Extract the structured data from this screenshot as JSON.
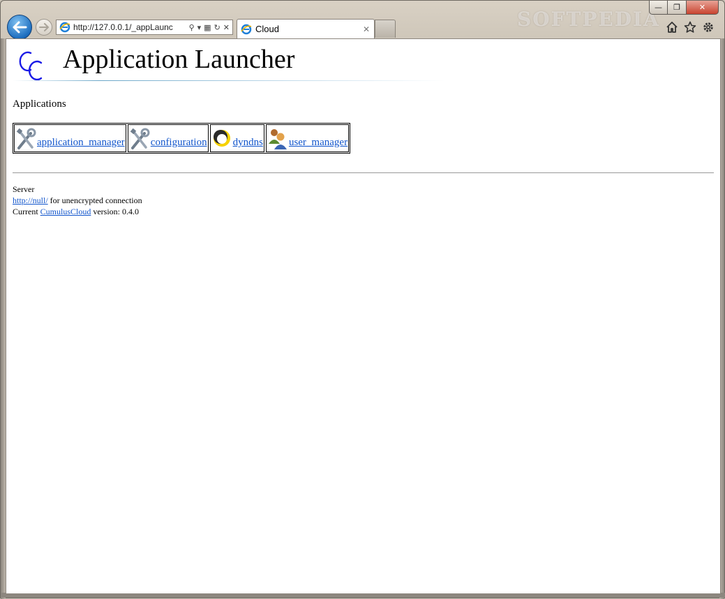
{
  "browser": {
    "address": "http://127.0.0.1/_appLaunc",
    "tab_title": "Cloud",
    "watermark": "SOFTPEDIA"
  },
  "page": {
    "title": "Application Launcher",
    "section_title": "Applications",
    "apps": [
      {
        "label": "application_manager",
        "icon": "tools-icon"
      },
      {
        "label": "configuration",
        "icon": "tools-icon"
      },
      {
        "label": "dyndns",
        "icon": "dyndns-ring-icon"
      },
      {
        "label": "user_manager",
        "icon": "users-icon"
      }
    ],
    "server": {
      "heading": "Server",
      "link": "http://null/",
      "link_suffix": " for unencrypted connection",
      "version_prefix": "Current ",
      "product_link": "CumulusCloud",
      "version_suffix": " version: 0.4.0"
    }
  },
  "colors": {
    "link": "#1155cc",
    "logo": "#1a1ae6"
  }
}
